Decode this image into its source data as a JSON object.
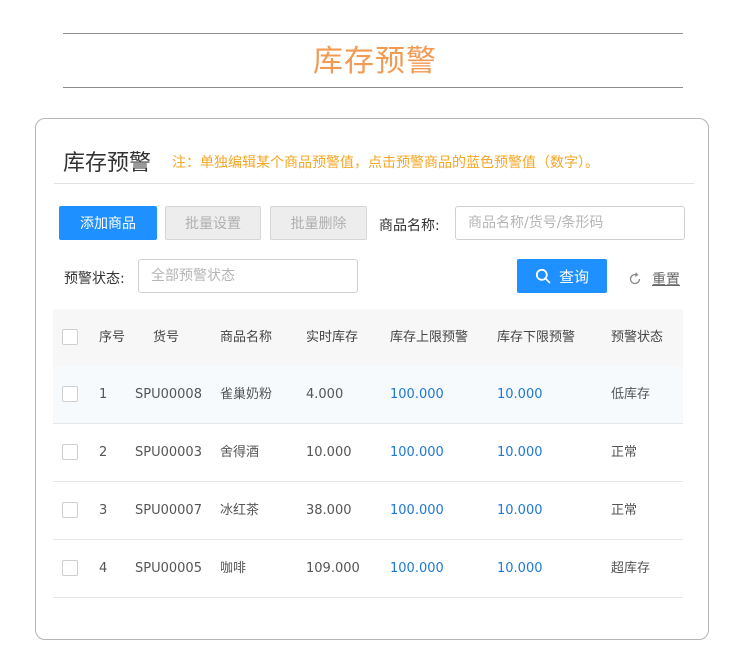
{
  "banner": {
    "title": "库存预警"
  },
  "card": {
    "title": "库存预警",
    "note": "注：单独编辑某个商品预警值，点击预警商品的蓝色预警值（数字）。"
  },
  "toolbar": {
    "add_label": "添加商品",
    "batch_set_label": "批量设置",
    "batch_delete_label": "批量删除",
    "name_label": "商品名称:",
    "name_placeholder": "商品名称/货号/条形码",
    "status_label": "预警状态:",
    "status_placeholder": "全部预警状态",
    "search_label": "查询",
    "reset_label": "重置"
  },
  "table": {
    "headers": {
      "index": "序号",
      "code": "货号",
      "name": "商品名称",
      "stock": "实时库存",
      "upper": "库存上限预警",
      "lower": "库存下限预警",
      "status": "预警状态"
    },
    "rows": [
      {
        "index": "1",
        "code": "SPU00008",
        "name": "雀巢奶粉",
        "stock": "4.000",
        "upper": "100.000",
        "lower": "10.000",
        "status": "低库存"
      },
      {
        "index": "2",
        "code": "SPU00003",
        "name": "舍得酒",
        "stock": "10.000",
        "upper": "100.000",
        "lower": "10.000",
        "status": "正常"
      },
      {
        "index": "3",
        "code": "SPU00007",
        "name": "冰红茶",
        "stock": "38.000",
        "upper": "100.000",
        "lower": "10.000",
        "status": "正常"
      },
      {
        "index": "4",
        "code": "SPU00005",
        "name": "咖啡",
        "stock": "109.000",
        "upper": "100.000",
        "lower": "10.000",
        "status": "超库存"
      }
    ]
  },
  "colors": {
    "primary": "#1e90ff",
    "accent_orange": "#f39a52",
    "note_orange": "#f5a623",
    "link_blue": "#1e78d6"
  },
  "icons": {
    "search": "search-icon",
    "reset": "refresh-icon"
  }
}
